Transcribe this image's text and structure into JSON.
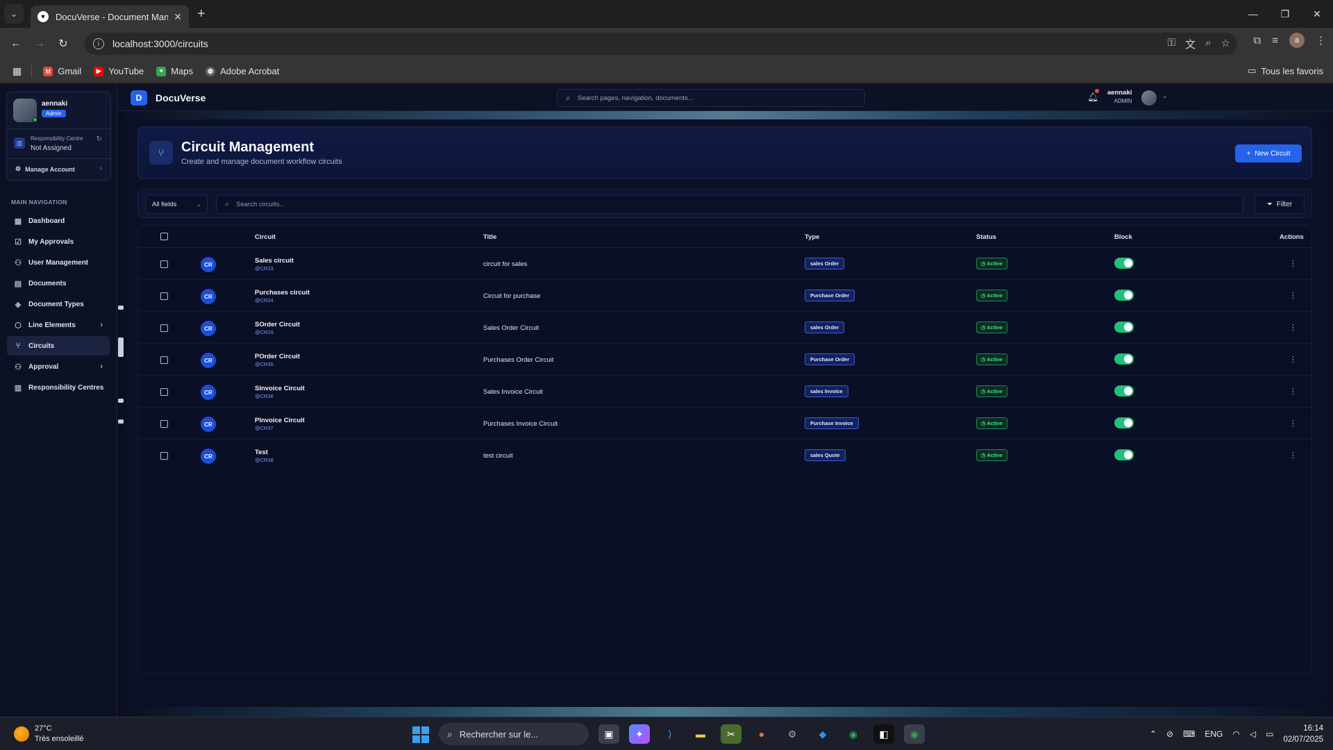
{
  "browser": {
    "tab_title": "DocuVerse - Document Manag",
    "tab_favicon": "heart-icon",
    "url": "localhost:3000/circuits",
    "bookmarks": [
      {
        "label": "Gmail",
        "icon": "gmail-icon",
        "color": "#ea4335"
      },
      {
        "label": "YouTube",
        "icon": "youtube-icon",
        "color": "#ff0000"
      },
      {
        "label": "Maps",
        "icon": "maps-icon",
        "color": "#34a853"
      },
      {
        "label": "Adobe Acrobat",
        "icon": "globe-icon",
        "color": "#9aa0a6"
      }
    ],
    "all_bookmarks": "Tous les favoris",
    "profile_initial": "a"
  },
  "sidebar": {
    "user_name": "aennaki",
    "user_role": "Admin",
    "rc_label": "Responsibility Centre",
    "rc_value": "Not Assigned",
    "manage_account": "Manage Account",
    "nav_title": "MAIN NAVIGATION",
    "items": [
      {
        "label": "Dashboard",
        "icon": "dashboard-icon",
        "glyph": "▦"
      },
      {
        "label": "My Approvals",
        "icon": "clipboard-check-icon",
        "glyph": "☑"
      },
      {
        "label": "User Management",
        "icon": "users-icon",
        "glyph": "⚇"
      },
      {
        "label": "Documents",
        "icon": "file-icon",
        "glyph": "▤"
      },
      {
        "label": "Document Types",
        "icon": "layers-icon",
        "glyph": "◈"
      },
      {
        "label": "Line Elements",
        "icon": "package-icon",
        "glyph": "⬡"
      },
      {
        "label": "Circuits",
        "icon": "git-branch-icon",
        "glyph": "⑂"
      },
      {
        "label": "Approval",
        "icon": "user-check-icon",
        "glyph": "⚇"
      },
      {
        "label": "Responsibility Centres",
        "icon": "building-icon",
        "glyph": "▥"
      }
    ]
  },
  "topbar": {
    "brand_letter": "D",
    "brand": "DocuVerse",
    "search_placeholder": "Search pages, navigation, documents...",
    "user_name": "aennaki",
    "user_role": "ADMIN"
  },
  "header": {
    "title": "Circuit Management",
    "subtitle": "Create and manage document workflow circuits",
    "new_button": "New Circuit"
  },
  "filters": {
    "field_select": "All fields",
    "search_placeholder": "Search circuits...",
    "filter_button": "Filter"
  },
  "table": {
    "columns": {
      "circuit": "Circuit",
      "title": "Title",
      "type": "Type",
      "status": "Status",
      "block": "Block",
      "actions": "Actions"
    },
    "rows": [
      {
        "avatar": "CR",
        "name": "Sales circuit",
        "code": "@CR23",
        "title": "circuit for sales",
        "type": "sales Order",
        "status": "Active",
        "block": true
      },
      {
        "avatar": "CR",
        "name": "Purchases circuit",
        "code": "@CR24",
        "title": "Circuit for purchase",
        "type": "Purchase Order",
        "status": "Active",
        "block": true
      },
      {
        "avatar": "CR",
        "name": "SOrder Circuit",
        "code": "@CR29",
        "title": "Sales Order Circuit",
        "type": "sales Order",
        "status": "Active",
        "block": true
      },
      {
        "avatar": "CR",
        "name": "POrder Circuit",
        "code": "@CR35",
        "title": "Purchases Order Circuit",
        "type": "Purchase Order",
        "status": "Active",
        "block": true
      },
      {
        "avatar": "CR",
        "name": "SInvoice Circuit",
        "code": "@CR36",
        "title": "Sales Invoice Circuit",
        "type": "sales Invoice",
        "status": "Active",
        "block": true
      },
      {
        "avatar": "CR",
        "name": "PInvoice Circuit",
        "code": "@CR37",
        "title": "Purchases Invoice Circuit",
        "type": "Purchase Invoice",
        "status": "Active",
        "block": true
      },
      {
        "avatar": "CR",
        "name": "Test",
        "code": "@CR38",
        "title": "test circuit",
        "type": "sales Quote",
        "status": "Active",
        "block": true
      }
    ]
  },
  "taskbar": {
    "temperature": "27°C",
    "weather": "Très ensoleillé",
    "search_placeholder": "Rechercher sur le...",
    "language": "ENG",
    "time": "16:14",
    "date": "02/07/2025"
  },
  "colors": {
    "accent": "#2563eb",
    "active_green": "#22c07a"
  }
}
